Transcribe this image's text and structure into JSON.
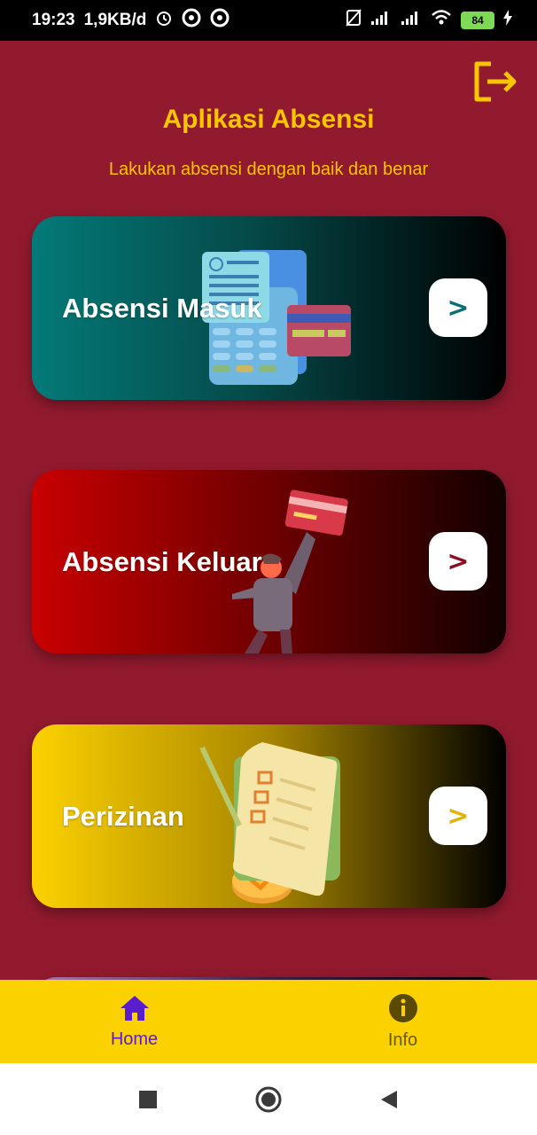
{
  "status_bar": {
    "time": "19:23",
    "speed": "1,9KB/d",
    "battery": "84"
  },
  "header": {
    "title": "Aplikasi Absensi",
    "subtitle": "Lakukan absensi dengan baik dan benar",
    "logout_icon": "logout-icon"
  },
  "cards": [
    {
      "label": "Absensi Masuk",
      "arrow": ">",
      "arrow_color": "#0a6f73",
      "icon": "payment-terminal-icon"
    },
    {
      "label": "Absensi Keluar",
      "arrow": ">",
      "arrow_color": "#8a0f24",
      "icon": "person-card-icon"
    },
    {
      "label": "Perizinan",
      "arrow": ">",
      "arrow_color": "#e0b400",
      "icon": "checklist-document-icon"
    }
  ],
  "bottom_nav": {
    "home_label": "Home",
    "info_label": "Info",
    "active": "Home"
  },
  "colors": {
    "background": "#921a2f",
    "accent": "#f7c600",
    "nav_bg": "#fcd100",
    "nav_active": "#5a1ccf"
  }
}
